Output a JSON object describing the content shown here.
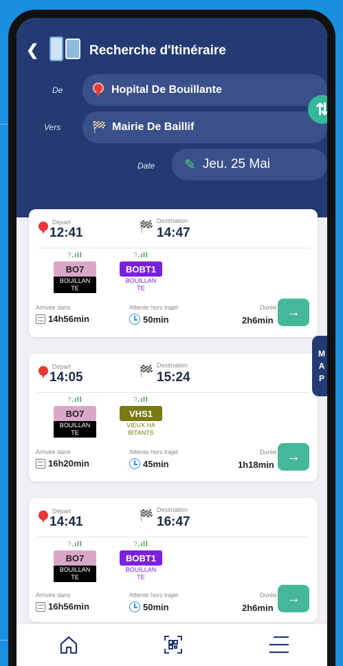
{
  "header": {
    "title": "Recherche d'Itinéraire",
    "from_label": "De",
    "from_value": "Hopital De Bouillante",
    "to_label": "Vers",
    "to_value": "Mairie De Baillif",
    "date_label": "Date",
    "date_value": "Jeu. 25 Mai"
  },
  "labels": {
    "depart": "Départ",
    "destination": "Destination",
    "arrival_in": "Arrivée dans",
    "wait": "Attente hors trajet",
    "duration": "Durée"
  },
  "map_tab": [
    "M",
    "A",
    "P"
  ],
  "trips": [
    {
      "depart": "12:41",
      "arrive": "14:47",
      "legs": [
        {
          "line": "BO7",
          "dest_l1": "BOUILLAN",
          "dest_l2": "TE",
          "badge_bg": "#d9a8c8",
          "badge_fg": "#222",
          "dest_bg": "#000",
          "dest_fg": "#fff"
        },
        {
          "line": "BOBT1",
          "dest_l1": "BOUILLAN",
          "dest_l2": "TE",
          "badge_bg": "#7b1fe0",
          "badge_fg": "#fff",
          "dest_bg": "#fff",
          "dest_fg": "#7b1fe0"
        }
      ],
      "arrival_in": "14h56min",
      "wait": "50min",
      "duration": "2h6min"
    },
    {
      "depart": "14:05",
      "arrive": "15:24",
      "legs": [
        {
          "line": "BO7",
          "dest_l1": "BOUILLAN",
          "dest_l2": "TE",
          "badge_bg": "#d9a8c8",
          "badge_fg": "#222",
          "dest_bg": "#000",
          "dest_fg": "#fff"
        },
        {
          "line": "VHS1",
          "dest_l1": "VIEUX HA",
          "dest_l2": "BITANTS",
          "badge_bg": "#7a7a12",
          "badge_fg": "#fff",
          "dest_bg": "#fff",
          "dest_fg": "#7a7a12"
        }
      ],
      "arrival_in": "16h20min",
      "wait": "45min",
      "duration": "1h18min"
    },
    {
      "depart": "14:41",
      "arrive": "16:47",
      "legs": [
        {
          "line": "BO7",
          "dest_l1": "BOUILLAN",
          "dest_l2": "TE",
          "badge_bg": "#d9a8c8",
          "badge_fg": "#222",
          "dest_bg": "#000",
          "dest_fg": "#fff"
        },
        {
          "line": "BOBT1",
          "dest_l1": "BOUILLAN",
          "dest_l2": "TE",
          "badge_bg": "#7b1fe0",
          "badge_fg": "#fff",
          "dest_bg": "#fff",
          "dest_fg": "#7b1fe0"
        }
      ],
      "arrival_in": "16h56min",
      "wait": "50min",
      "duration": "2h6min"
    }
  ],
  "colors": {
    "header_bg": "#243a73",
    "accent": "#45b89a",
    "page_bg": "#1a8fe0"
  },
  "icons": [
    "back-arrow-icon",
    "swap-icon",
    "pencil-icon",
    "home-icon",
    "qr-scan-icon",
    "menu-icon"
  ]
}
